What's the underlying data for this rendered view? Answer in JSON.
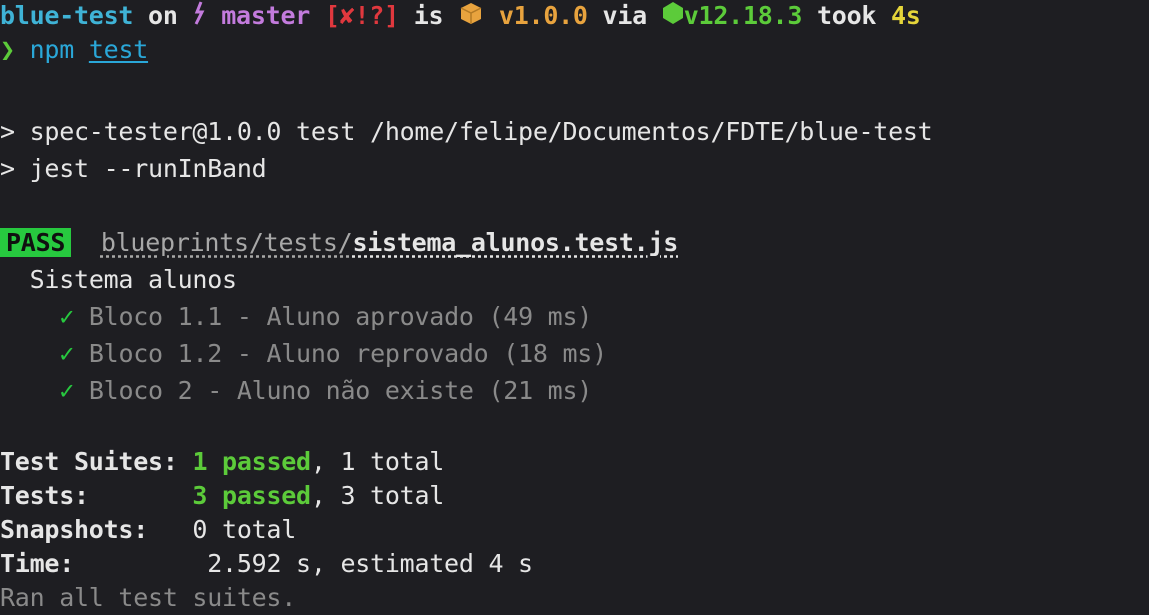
{
  "prompt": {
    "dir": "blue-test",
    "on": " on ",
    "branch": "master",
    "git_status": "[✘!?]",
    "is": " is ",
    "pkg_version": "v1.0.0",
    "via": " via ",
    "node_version": "v12.18.3",
    "took": " took ",
    "duration": "4s",
    "prompt_char": "❯",
    "cmd": "npm",
    "arg": "test"
  },
  "npm_output": [
    "> spec-tester@1.0.0 test /home/felipe/Documentos/FDTE/blue-test",
    "> jest --runInBand"
  ],
  "result": {
    "badge": "PASS",
    "file_dir": "blueprints/tests/",
    "file_name": "sistema_alunos.test.js",
    "suite": "Sistema alunos",
    "tests": [
      {
        "check": "✓",
        "label": "Bloco 1.1 - Aluno aprovado (49 ms)"
      },
      {
        "check": "✓",
        "label": "Bloco 1.2 - Aluno reprovado (18 ms)"
      },
      {
        "check": "✓",
        "label": "Bloco 2 - Aluno não existe (21 ms)"
      }
    ]
  },
  "summary": {
    "suites_label": "Test Suites:",
    "suites_passed": "1 passed",
    "suites_total": ", 1 total",
    "tests_label": "Tests:",
    "tests_passed": "3 passed",
    "tests_total": ", 3 total",
    "snap_label": "Snapshots:",
    "snap_value": "0 total",
    "time_label": "Time:",
    "time_value": "2.592 s, estimated 4 s",
    "footer": "Ran all test suites."
  },
  "colors": {
    "background": "#1e1e22",
    "pass_badge": "#27c93f",
    "branch": "#c37bdd",
    "git_status": "#e0383e"
  },
  "icons": [
    "git-branch-icon",
    "package-icon",
    "nodejs-icon"
  ]
}
